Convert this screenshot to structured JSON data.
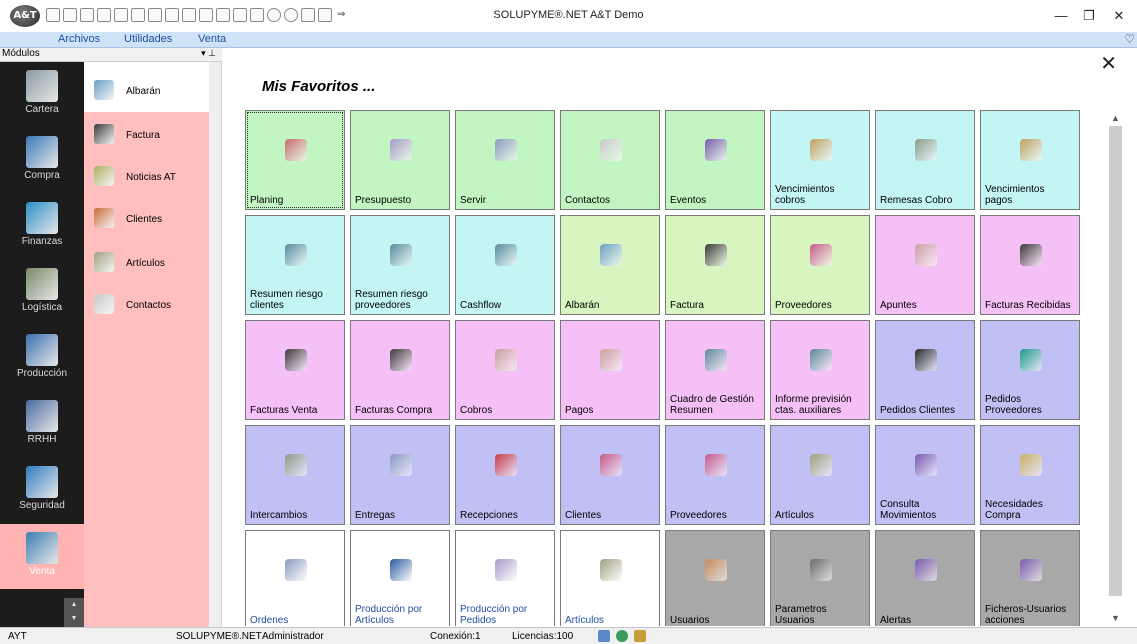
{
  "title_bar": {
    "logo_text": "A&T",
    "window_title": "SOLUPYME®.NET A&T Demo",
    "qat_icons": [
      "new-doc-icon",
      "open-doc-icon",
      "delete-icon",
      "copy-icon",
      "table-icon",
      "grid-icon",
      "export-icon",
      "import-icon",
      "print-icon",
      "mail-icon",
      "report-icon",
      "tools-icon",
      "settings-icon",
      "refresh-icon",
      "clock-icon",
      "search-icon",
      "home-icon"
    ],
    "qat_dropdown": "⇒",
    "controls": {
      "minimize": "—",
      "restore": "❐",
      "close": "✕"
    }
  },
  "menu": {
    "items": [
      "Archivos",
      "Utilidades",
      "Venta"
    ],
    "heart": "♡"
  },
  "modules": {
    "header": "Módulos",
    "pin": "▾ ⊥",
    "items": [
      {
        "label": "Cartera",
        "icon": "cartera-icon",
        "color": "#8a9aa0"
      },
      {
        "label": "Compra",
        "icon": "compra-icon",
        "color": "#3a78b8"
      },
      {
        "label": "Finanzas",
        "icon": "finanzas-icon",
        "color": "#2a8fc8"
      },
      {
        "label": "Logística",
        "icon": "logistica-icon",
        "color": "#7a8a6a"
      },
      {
        "label": "Producción",
        "icon": "produccion-icon",
        "color": "#3a6fb0"
      },
      {
        "label": "RRHH",
        "icon": "rrhh-icon",
        "color": "#4a6aa0"
      },
      {
        "label": "Seguridad",
        "icon": "seguridad-icon",
        "color": "#2f7cc0"
      },
      {
        "label": "Venta",
        "icon": "venta-icon",
        "color": "#3a7fb0"
      }
    ],
    "selected": "Venta",
    "scroll_up": "▲",
    "scroll_down": "▼"
  },
  "submodules": [
    {
      "label": "Albarán",
      "icon": "clipboard-icon",
      "color": "#6aa0c8"
    },
    {
      "label": "Factura",
      "icon": "invoice-check-icon",
      "color": "#3a3a3a"
    },
    {
      "label": "Noticias AT",
      "icon": "news-icon",
      "color": "#b0b060"
    },
    {
      "label": "Clientes",
      "icon": "clients-icon",
      "color": "#c86a3a"
    },
    {
      "label": "Artículos",
      "icon": "articles-icon",
      "color": "#a0a080"
    },
    {
      "label": "Contactos",
      "icon": "contacts-icon",
      "color": "#c8c8c8"
    }
  ],
  "favorites": {
    "title": "Mis Favoritos ...",
    "close": "✕",
    "scroll_up": "▲",
    "scroll_down": "▼",
    "tiles": [
      [
        {
          "label": "Planing",
          "bg": "#c3f5c3",
          "icon_color": "#c86a6a",
          "text_color": "#000"
        },
        {
          "label": "Presupuesto",
          "bg": "#c3f5c3",
          "icon_color": "#a89ac8",
          "text_color": "#000"
        },
        {
          "label": "Servir",
          "bg": "#c3f5c3",
          "icon_color": "#8a9ac0",
          "text_color": "#000"
        },
        {
          "label": "Contactos",
          "bg": "#c3f5c3",
          "icon_color": "#c8c8c8",
          "text_color": "#000"
        },
        {
          "label": "Eventos",
          "bg": "#c3f5c3",
          "icon_color": "#7a5ab0",
          "text_color": "#000"
        },
        {
          "label": "Vencimientos\ncobros",
          "bg": "#c3f5f5",
          "icon_color": "#c0a060",
          "text_color": "#000"
        },
        {
          "label": "Remesas Cobro",
          "bg": "#c3f5f5",
          "icon_color": "#8a9a8a",
          "text_color": "#000"
        },
        {
          "label": "Vencimientos\npagos",
          "bg": "#c3f5f5",
          "icon_color": "#c0a060",
          "text_color": "#000"
        }
      ],
      [
        {
          "label": "Resumen riesgo\nclientes",
          "bg": "#c3f5f5",
          "icon_color": "#5a8a9a",
          "text_color": "#000"
        },
        {
          "label": "Resumen riesgo\nproveedores",
          "bg": "#c3f5f5",
          "icon_color": "#5a8a9a",
          "text_color": "#000"
        },
        {
          "label": "Cashflow",
          "bg": "#c3f5f5",
          "icon_color": "#5a8a9a",
          "text_color": "#000"
        },
        {
          "label": "Albarán",
          "bg": "#d8f5c0",
          "icon_color": "#6aa0c8",
          "text_color": "#000"
        },
        {
          "label": "Factura",
          "bg": "#d8f5c0",
          "icon_color": "#3a3a3a",
          "text_color": "#000"
        },
        {
          "label": "Proveedores",
          "bg": "#d8f5c0",
          "icon_color": "#c85a8a",
          "text_color": "#000"
        },
        {
          "label": "Apuntes",
          "bg": "#f5c0f5",
          "icon_color": "#c8a0a0",
          "text_color": "#000"
        },
        {
          "label": "Facturas Recibidas",
          "bg": "#f5c0f5",
          "icon_color": "#3a3a3a",
          "text_color": "#000"
        }
      ],
      [
        {
          "label": "Facturas Venta",
          "bg": "#f5c0f5",
          "icon_color": "#3a3a3a",
          "text_color": "#000"
        },
        {
          "label": "Facturas Compra",
          "bg": "#f5c0f5",
          "icon_color": "#3a3a3a",
          "text_color": "#000"
        },
        {
          "label": "Cobros",
          "bg": "#f5c0f5",
          "icon_color": "#c8a0a0",
          "text_color": "#000"
        },
        {
          "label": "Pagos",
          "bg": "#f5c0f5",
          "icon_color": "#c8a0a0",
          "text_color": "#000"
        },
        {
          "label": "Cuadro de Gestión\nResumen",
          "bg": "#f5c0f5",
          "icon_color": "#5a8a9a",
          "text_color": "#000"
        },
        {
          "label": "Informe previsión\nctas. auxiliares",
          "bg": "#f5c0f5",
          "icon_color": "#5a8a9a",
          "text_color": "#000"
        },
        {
          "label": "Pedidos Clientes",
          "bg": "#c0c0f5",
          "icon_color": "#2a2a2a",
          "text_color": "#000"
        },
        {
          "label": "Pedidos\nProveedores",
          "bg": "#c0c0f5",
          "icon_color": "#1a9a8a",
          "text_color": "#000"
        }
      ],
      [
        {
          "label": "Intercambios",
          "bg": "#c0c0f5",
          "icon_color": "#8a9a8a",
          "text_color": "#000"
        },
        {
          "label": "Entregas",
          "bg": "#c0c0f5",
          "icon_color": "#8a9ac0",
          "text_color": "#000"
        },
        {
          "label": "Recepciones",
          "bg": "#c0c0f5",
          "icon_color": "#c83a4a",
          "text_color": "#000"
        },
        {
          "label": "Clientes",
          "bg": "#c0c0f5",
          "icon_color": "#c85a8a",
          "text_color": "#000"
        },
        {
          "label": "Proveedores",
          "bg": "#c0c0f5",
          "icon_color": "#c85a8a",
          "text_color": "#000"
        },
        {
          "label": "Artículos",
          "bg": "#c0c0f5",
          "icon_color": "#a0a080",
          "text_color": "#000"
        },
        {
          "label": "Consulta\nMovimientos",
          "bg": "#c0c0f5",
          "icon_color": "#7a5ab0",
          "text_color": "#000"
        },
        {
          "label": "Necesidades\nCompra",
          "bg": "#c0c0f5",
          "icon_color": "#c8b060",
          "text_color": "#000"
        }
      ],
      [
        {
          "label": "Ordenes",
          "bg": "#ffffff",
          "icon_color": "#8a9ac0",
          "text_color": "#1f4fa0"
        },
        {
          "label": "Producción por\nArtículos",
          "bg": "#ffffff",
          "icon_color": "#2a5aa0",
          "text_color": "#1f4fa0"
        },
        {
          "label": "Producción por\nPedidos",
          "bg": "#ffffff",
          "icon_color": "#a89ac8",
          "text_color": "#1f4fa0"
        },
        {
          "label": "Artículos",
          "bg": "#ffffff",
          "icon_color": "#a0a080",
          "text_color": "#1f4fa0"
        },
        {
          "label": "Usuarios",
          "bg": "#a8a8a8",
          "icon_color": "#c88a5a",
          "text_color": "#000"
        },
        {
          "label": "Parametros\nUsuarios",
          "bg": "#a8a8a8",
          "icon_color": "#6a6a6a",
          "text_color": "#000"
        },
        {
          "label": "Alertas",
          "bg": "#a8a8a8",
          "icon_color": "#7a5ab0",
          "text_color": "#000"
        },
        {
          "label": "Ficheros-Usuarios\nacciones",
          "bg": "#a8a8a8",
          "icon_color": "#7a5ab0",
          "text_color": "#000"
        }
      ]
    ]
  },
  "status_bar": {
    "company": "AYT",
    "product": "SOLUPYME®.NET",
    "user": "Administrador",
    "connection": "Conexión:1",
    "licenses": "Licencias:100"
  }
}
